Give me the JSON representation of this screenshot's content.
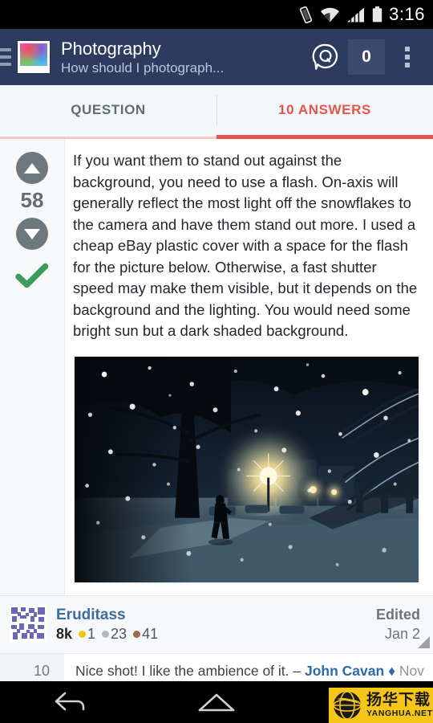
{
  "status_bar": {
    "time": "3:16",
    "icons": [
      "vibrate-icon",
      "wifi-icon",
      "signal-icon",
      "battery-icon"
    ]
  },
  "app_bar": {
    "menu_icon": "hamburger-menu-icon",
    "logo": "photography-site-logo",
    "title": "Photography",
    "subtitle": "How should I photograph...",
    "ask_icon": "question-bubble-icon",
    "inbox_count": "0",
    "overflow_icon": "overflow-menu-icon",
    "background_color": "#2d3c5e"
  },
  "tabs": {
    "accent_color": "#e4564b",
    "items": [
      {
        "label": "QUESTION",
        "active": false
      },
      {
        "label": "10 ANSWERS",
        "active": true
      }
    ]
  },
  "answer": {
    "score": "58",
    "upvote_icon": "upvote-arrow-icon",
    "downvote_icon": "downvote-arrow-icon",
    "accepted_icon": "accepted-check-icon",
    "accepted_color": "#3e9b5f",
    "body": "If you want them to stand out against the background, you need to use a flash. On-axis will generally reflect the most light off the snowflakes to the camera and have them stand out more. I used a cheap eBay plastic cover with a space for the flash for the picture below. Otherwise, a fast shutter speed may make them visible, but it depends on the background and the lighting. You would need some bright sun but a dark shaded background.",
    "image_alt": "night-snowfall-street-photo"
  },
  "user_card": {
    "avatar": "user-avatar-identicon",
    "name": "Eruditass",
    "reputation": "8k",
    "badges": [
      {
        "type": "gold",
        "count": "1",
        "color": "#f1c40f"
      },
      {
        "type": "silver",
        "count": "23",
        "color": "#b6b8bb"
      },
      {
        "type": "bronze",
        "count": "41",
        "color": "#9c6b4a"
      }
    ],
    "action_label": "Edited",
    "date": "Jan 2"
  },
  "comment": {
    "score": "10",
    "text": "Nice shot! I like the ambience of it. – ",
    "author": "John Cavan",
    "diamond": "♦",
    "date": "Nov"
  },
  "nav_bar": {
    "back_icon": "back-arrow-icon",
    "home_icon": "home-icon",
    "recents_icon": "recent-apps-icon"
  },
  "watermark": {
    "cn": "扬华下载",
    "en": "YANGHUA.NET",
    "color": "#f5c518"
  }
}
